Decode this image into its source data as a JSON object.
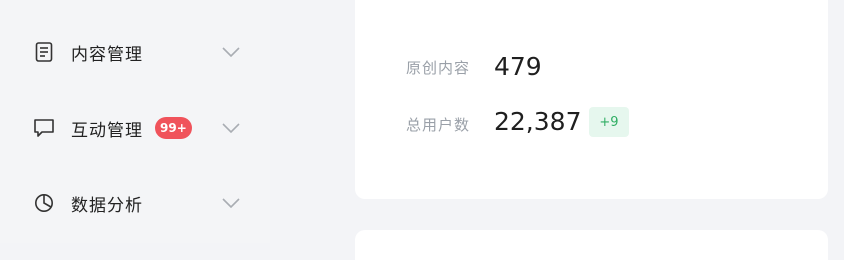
{
  "sidebar": {
    "items": [
      {
        "label": "内容管理",
        "icon": "document-icon"
      },
      {
        "label": "互动管理",
        "icon": "chat-bubble-icon",
        "badge": "99+"
      },
      {
        "label": "数据分析",
        "icon": "pie-chart-icon"
      }
    ]
  },
  "stats": {
    "original_content": {
      "label": "原创内容",
      "value": "479"
    },
    "total_users": {
      "label": "总用户数",
      "value": "22,387",
      "delta": "+9"
    }
  },
  "colors": {
    "badge": "#f0535b",
    "delta_bg": "#e6f7ee",
    "delta_text": "#2fae63",
    "label_gray": "#9aa0a8"
  }
}
